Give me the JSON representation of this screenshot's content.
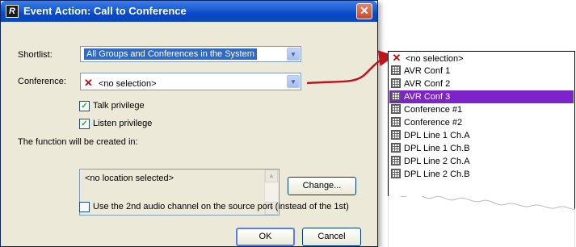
{
  "dialog": {
    "title": "Event Action: Call to Conference",
    "close_glyph": "✕",
    "app_icon_letter": "R",
    "shortlist_label": "Shortlist:",
    "shortlist_value": "All Groups and Conferences in the System",
    "conference_label": "Conference:",
    "conference_value": "<no selection>",
    "talk_privilege": "Talk privilege",
    "listen_privilege": "Listen privilege",
    "function_created_label": "The function will be created in:",
    "location_value": "<no location selected>",
    "change_button": "Change...",
    "second_channel_label": "Use the 2nd audio channel on the source port (instead of the 1st)",
    "ok_button": "OK",
    "cancel_button": "Cancel",
    "checkboxes": {
      "talk_checked": true,
      "listen_checked": true,
      "second_channel_checked": false
    }
  },
  "dropdown": {
    "items": [
      {
        "label": "<no selection>",
        "icon": "x-icon",
        "selected": false
      },
      {
        "label": "AVR Conf 1",
        "icon": "grid-icon",
        "selected": false
      },
      {
        "label": "AVR Conf 2",
        "icon": "grid-icon",
        "selected": false
      },
      {
        "label": "AVR Conf 3",
        "icon": "grid-icon",
        "selected": true
      },
      {
        "label": "Conference #1",
        "icon": "grid-icon",
        "selected": false
      },
      {
        "label": "Conference #2",
        "icon": "grid-icon",
        "selected": false
      },
      {
        "label": "DPL Line 1 Ch.A",
        "icon": "grid-icon",
        "selected": false
      },
      {
        "label": "DPL Line 1 Ch.B",
        "icon": "grid-icon",
        "selected": false
      },
      {
        "label": "DPL Line 2 Ch.A",
        "icon": "grid-icon",
        "selected": false
      },
      {
        "label": "DPL Line 2 Ch.B",
        "icon": "grid-icon",
        "selected": false
      }
    ]
  },
  "colors": {
    "selected_item": "#7e22c9",
    "arrow": "#c0141c",
    "title_bar": "#0a49c7",
    "dialog_bg": "#ece9d8"
  }
}
